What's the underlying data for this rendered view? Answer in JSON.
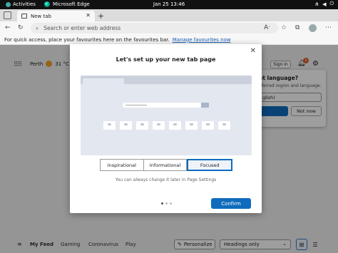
{
  "topbar": {
    "activities": "Activities",
    "app_name": "Microsoft Edge",
    "clock": "Jan 25  13:46"
  },
  "tabs": [
    {
      "label": "New tab"
    }
  ],
  "address_bar": {
    "placeholder": "Search or enter web address"
  },
  "favourites_bar": {
    "text": "For quick access, place your favourites here on the favourites bar.",
    "link": "Manage favourites now"
  },
  "ntp": {
    "weather_city": "Perth",
    "weather_temp": "31 °C",
    "signin": "Sign in",
    "notification_count": "1"
  },
  "language_popup": {
    "question": "nt language?",
    "subtitle": "eferred region and language.",
    "selected": "glish)",
    "not_now": "Not now"
  },
  "modal": {
    "title": "Let's set up your new tab page",
    "layout_options": [
      "Inspirational",
      "Informational",
      "Focused"
    ],
    "selected_option": "Focused",
    "hint": "You can always change it later in Page Settings",
    "confirm": "Confirm",
    "page_indicator": {
      "total": 3,
      "current": 1
    }
  },
  "feed": {
    "tabs": [
      "My Feed",
      "Gaming",
      "Coronavirus",
      "Play"
    ],
    "personalize": "Personalize",
    "headings": "Headings only"
  },
  "colors": {
    "accent": "#0f6cbd",
    "overlay": "rgba(0,0,0,0.38)"
  },
  "icons": [
    "app-icon",
    "edge-icon",
    "network-icon",
    "volume-icon",
    "power-icon",
    "tab-actions-icon",
    "tab-icon",
    "close-icon",
    "plus-icon",
    "back-icon",
    "refresh-icon",
    "search-icon",
    "read-aloud-icon",
    "favourite-icon",
    "collections-icon",
    "profile-icon",
    "more-icon",
    "apps-grid-icon",
    "sun-icon",
    "bell-icon",
    "gear-icon",
    "menu-icon",
    "personalize-icon",
    "chevron-down-icon",
    "grid-view-icon",
    "list-view-icon"
  ]
}
